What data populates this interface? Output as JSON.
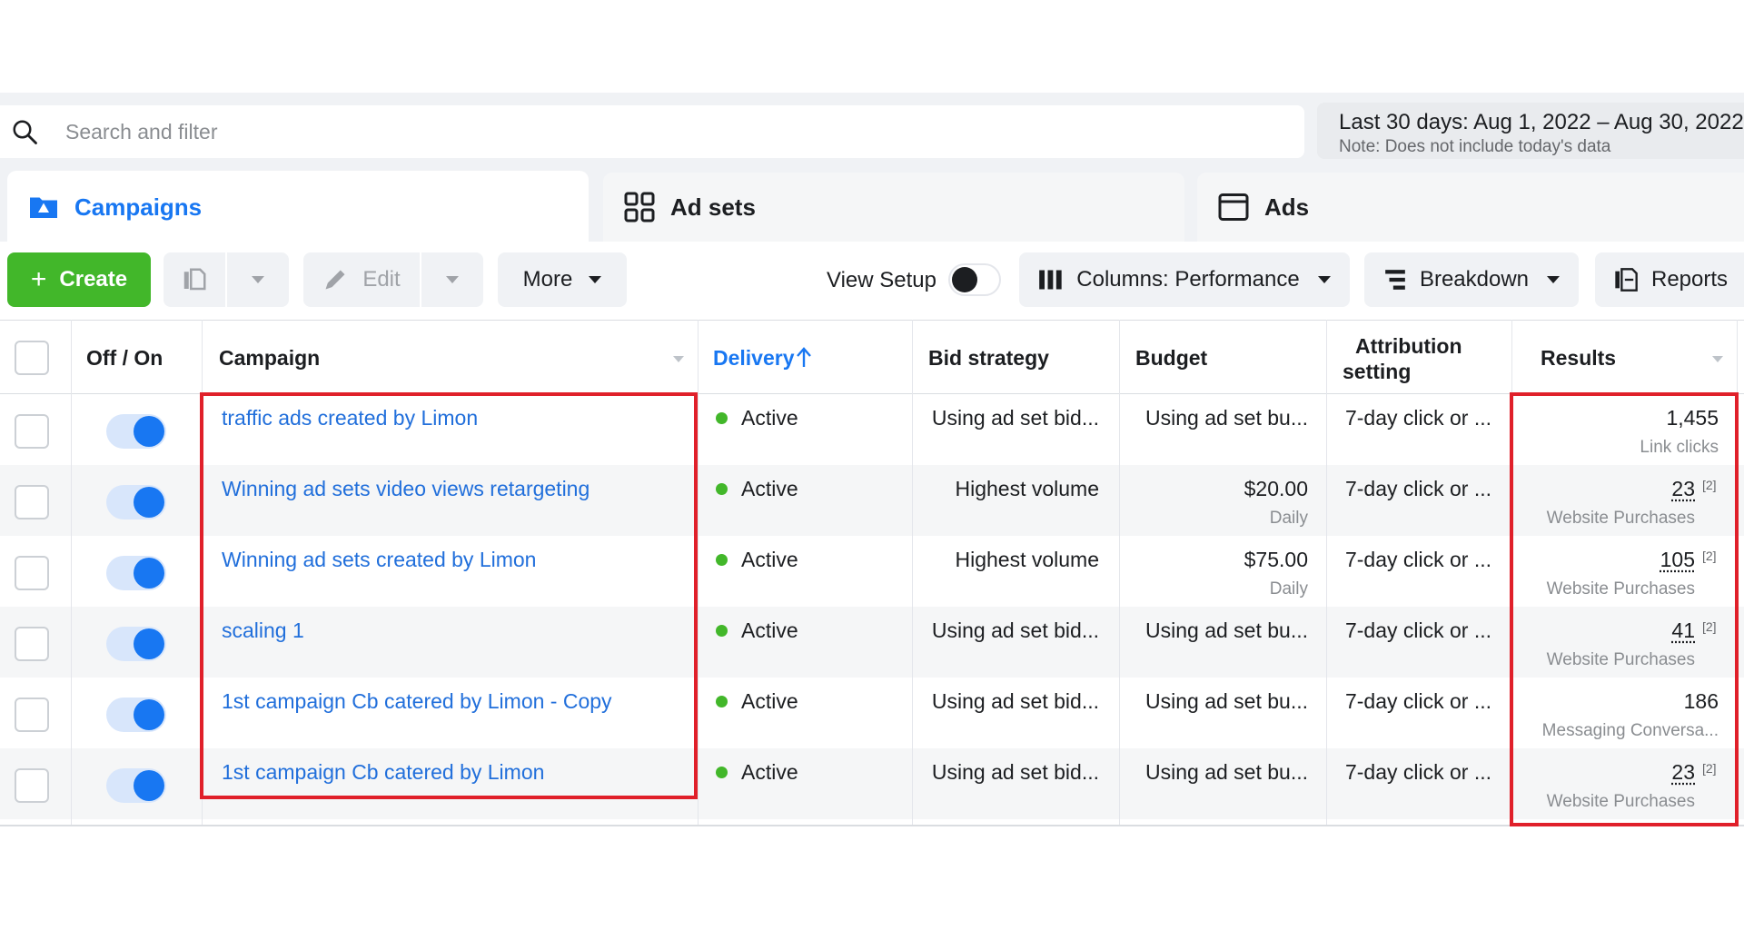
{
  "search": {
    "placeholder": "Search and filter"
  },
  "date_range": {
    "label": "Last 30 days: Aug 1, 2022 – Aug 30, 2022",
    "note": "Note: Does not include today's data"
  },
  "tabs": [
    {
      "label": "Campaigns",
      "active": true,
      "icon": "folder-icon"
    },
    {
      "label": "Ad sets",
      "active": false,
      "icon": "grid-icon"
    },
    {
      "label": "Ads",
      "active": false,
      "icon": "ad-window-icon"
    }
  ],
  "toolbar": {
    "create_label": "Create",
    "edit_label": "Edit",
    "more_label": "More",
    "view_setup_label": "View Setup",
    "columns_label": "Columns: Performance",
    "breakdown_label": "Breakdown",
    "reports_label": "Reports"
  },
  "columns": {
    "onoff": "Off / On",
    "campaign": "Campaign",
    "delivery": "Delivery",
    "bid_strategy": "Bid strategy",
    "budget": "Budget",
    "attribution_1": "Attribution",
    "attribution_2": "setting",
    "results": "Results"
  },
  "rows": [
    {
      "campaign": "traffic ads created by Limon",
      "delivery": "Active",
      "bid_strategy": "Using ad set bid...",
      "budget": "Using ad set bu...",
      "budget_sub": "",
      "attribution": "7-day click or ...",
      "result": "1,455",
      "result_sup": "",
      "result_sub": "Link clicks"
    },
    {
      "campaign": "Winning ad sets video views retargeting",
      "delivery": "Active",
      "bid_strategy": "Highest volume",
      "budget": "$20.00",
      "budget_sub": "Daily",
      "attribution": "7-day click or ...",
      "result": "23",
      "result_sup": "[2]",
      "result_sub": "Website Purchases"
    },
    {
      "campaign": "Winning ad sets created by Limon",
      "delivery": "Active",
      "bid_strategy": "Highest volume",
      "budget": "$75.00",
      "budget_sub": "Daily",
      "attribution": "7-day click or ...",
      "result": "105",
      "result_sup": "[2]",
      "result_sub": "Website Purchases"
    },
    {
      "campaign": "scaling 1",
      "delivery": "Active",
      "bid_strategy": "Using ad set bid...",
      "budget": "Using ad set bu...",
      "budget_sub": "",
      "attribution": "7-day click or ...",
      "result": "41",
      "result_sup": "[2]",
      "result_sub": "Website Purchases"
    },
    {
      "campaign": "1st campaign Cb catered by Limon - Copy",
      "delivery": "Active",
      "bid_strategy": "Using ad set bid...",
      "budget": "Using ad set bu...",
      "budget_sub": "",
      "attribution": "7-day click or ...",
      "result": "186",
      "result_sup": "",
      "result_sub": "Messaging Conversa..."
    },
    {
      "campaign": "1st campaign Cb catered by Limon",
      "delivery": "Active",
      "bid_strategy": "Using ad set bid...",
      "budget": "Using ad set bu...",
      "budget_sub": "",
      "attribution": "7-day click or ...",
      "result": "23",
      "result_sup": "[2]",
      "result_sub": "Website Purchases"
    }
  ],
  "colors": {
    "brand_blue": "#1877f2",
    "create_green": "#42b72a",
    "active_green": "#42b72a",
    "highlight_red": "#e0202a"
  }
}
